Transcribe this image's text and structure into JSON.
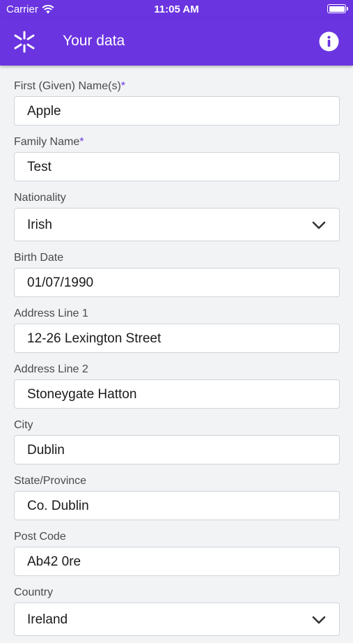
{
  "status_bar": {
    "carrier": "Carrier",
    "time": "11:05 AM"
  },
  "header": {
    "title": "Your data",
    "accent": "#6a34e0"
  },
  "fields": {
    "first_name": {
      "label": "First (Given) Name(s)",
      "required": "*",
      "value": "Apple"
    },
    "family_name": {
      "label": "Family Name",
      "required": "*",
      "value": "Test"
    },
    "nationality": {
      "label": "Nationality",
      "value": "Irish"
    },
    "birth_date": {
      "label": "Birth Date",
      "value": "01/07/1990"
    },
    "address1": {
      "label": "Address Line 1",
      "value": "12-26 Lexington Street"
    },
    "address2": {
      "label": "Address Line 2",
      "value": "Stoneygate Hatton"
    },
    "city": {
      "label": "City",
      "value": "Dublin"
    },
    "state": {
      "label": "State/Province",
      "value": "Co. Dublin"
    },
    "post_code": {
      "label": "Post Code",
      "value": "Ab42 0re"
    },
    "country": {
      "label": "Country",
      "value": "Ireland"
    }
  }
}
